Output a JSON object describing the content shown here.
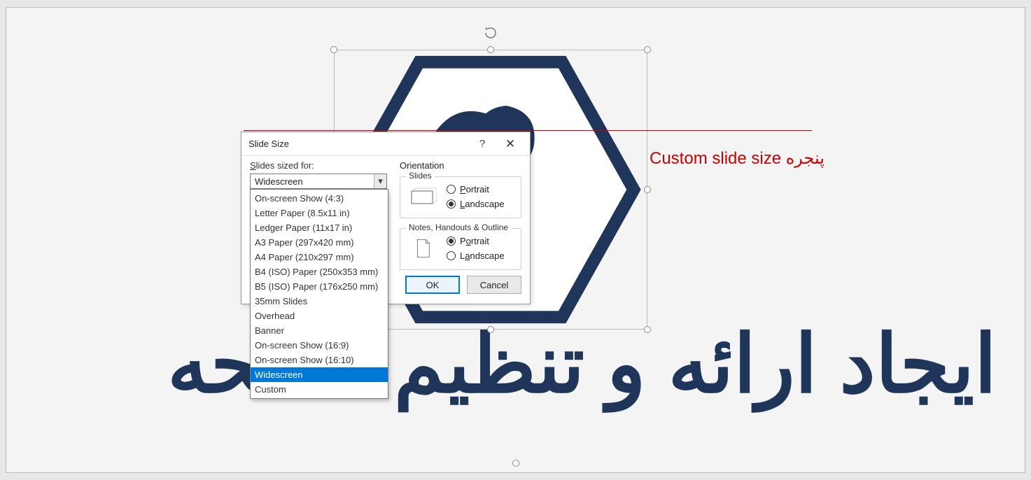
{
  "background": {
    "title_persian": "ایجاد ارائه و تنظیم صفحه"
  },
  "annotation": {
    "label": "پنجره Custom slide size"
  },
  "dialog": {
    "title": "Slide Size",
    "help_tip": "?",
    "close_tip": "✕",
    "slides_sized_for_label": "Slides sized for:",
    "combo_value": "Widescreen",
    "options": [
      "On-screen Show (4:3)",
      "Letter Paper (8.5x11 in)",
      "Ledger Paper (11x17 in)",
      "A3 Paper (297x420 mm)",
      "A4 Paper (210x297 mm)",
      "B4 (ISO) Paper (250x353 mm)",
      "B5 (ISO) Paper (176x250 mm)",
      "35mm Slides",
      "Overhead",
      "Banner",
      "On-screen Show (16:9)",
      "On-screen Show (16:10)",
      "Widescreen",
      "Custom"
    ],
    "selected_option_index": 12,
    "orientation_heading": "Orientation",
    "groups": {
      "slides": {
        "legend": "Slides",
        "portrait": "Portrait",
        "landscape": "Landscape",
        "portrait_u": "P",
        "landscape_u": "L",
        "selected": "landscape"
      },
      "notes": {
        "legend": "Notes, Handouts & Outline",
        "portrait": "Portrait",
        "landscape": "Landscape",
        "portrait_u2": "o",
        "landscape_u2": "a",
        "selected": "portrait"
      }
    },
    "ok": "OK",
    "cancel": "Cancel"
  }
}
